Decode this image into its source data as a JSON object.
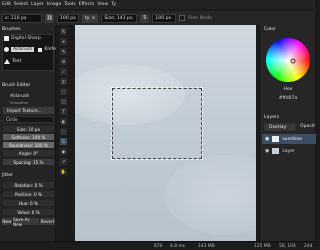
{
  "menu": {
    "items": [
      "Edit",
      "Select",
      "Layer",
      "Image",
      "Tools",
      "Effects",
      "View"
    ],
    "extra": "Ty"
  },
  "options": {
    "pos_x": "x: 110 px",
    "width": "100 px",
    "size": "Size: 143 px",
    "height": "100 px",
    "free_mode": "Free Mode",
    "tab_label": "ty",
    "tab_close": "×"
  },
  "left": {
    "brushes_header": "Brushes",
    "brush1": "Digital Sharp",
    "brush2": "Airbrush",
    "brush3": "Knife",
    "brush4": "Text",
    "editor_header": "Brush Editor",
    "brush_name": "Airbrush",
    "brush_sub": "Smoother",
    "import": "Import Texture...",
    "shape": "Circle",
    "size": "Size: 10 px",
    "softness": "Softness: 100 %",
    "roundness": "Roundness: 100 %",
    "angle": "Angle: 0°",
    "spacing": "Spacing: 15 %",
    "jitter_header": "Jitter",
    "rotation": "Rotation: 0 %",
    "position": "Position: 0 %",
    "hue": "Hue: 0 %",
    "value": "Value: 0 %",
    "btn_new": "New",
    "btn_save_as_new": "Save As New",
    "btn_revert": "Revert"
  },
  "tools": [
    "R",
    "⌖",
    "✎",
    "⊘",
    "⟋",
    "◫",
    "◌",
    "▢",
    "T",
    "◐",
    "⬚",
    "S",
    "◆",
    "↗",
    "✋"
  ],
  "right": {
    "color_header": "Color",
    "hex_label": "Hex",
    "hex_value": "#ffd07a",
    "layers_header": "Layers",
    "blend_mode": "Overlay",
    "opacity_label": "Opacit",
    "layers": [
      {
        "name": "sunshine",
        "active": true
      },
      {
        "name": "Layer",
        "active": false
      }
    ],
    "colors": {
      "accent": "#3a4f66",
      "hex_text": "#cfcfcf"
    }
  },
  "status": {
    "pointer": "870",
    "time": "4.8 ms",
    "mem_used": "143 MB",
    "mem_total": "125 MB",
    "coords": "56, 104",
    "size": "244"
  }
}
